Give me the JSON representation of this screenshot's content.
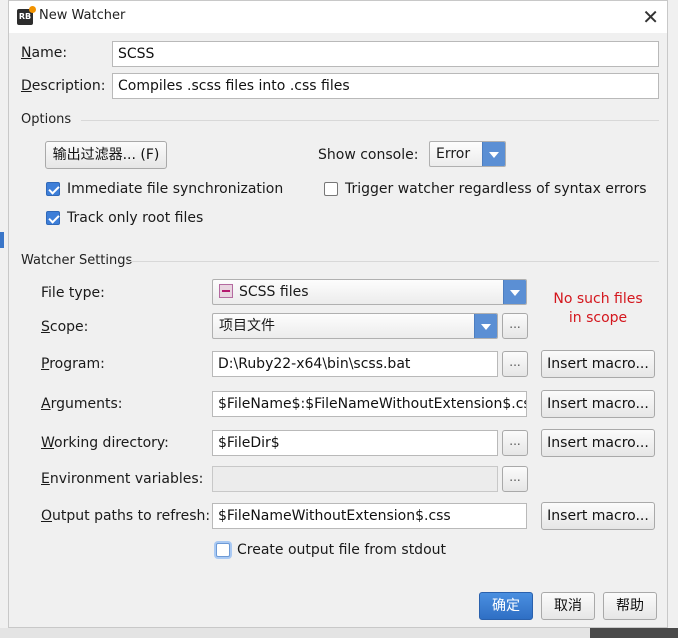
{
  "window": {
    "title": "New Watcher",
    "close_glyph": "✕"
  },
  "form": {
    "name_label": "Name:",
    "name_label_mn": "N",
    "name_label_rest": "ame:",
    "name_value": "SCSS",
    "description_label_mn": "D",
    "description_label_rest": "escription:",
    "description_value": "Compiles .scss files into .css files"
  },
  "options": {
    "title": "Options",
    "filter_button": "输出过滤器... (F)",
    "show_console_label": "Show console:",
    "show_console_value": "Error",
    "immediate_sync_label": "Immediate file synchronization",
    "immediate_sync_checked": true,
    "track_root_label": "Track only root files",
    "track_root_checked": true,
    "trigger_label": "Trigger watcher regardless of syntax errors",
    "trigger_checked": false
  },
  "watcher": {
    "title": "Watcher Settings",
    "file_type_label": "File type:",
    "file_type_value": "SCSS files",
    "file_type_icon": "sass-file-icon",
    "scope_label_mn": "S",
    "scope_label_rest": "cope:",
    "scope_value": "项目文件",
    "scope_error_line1": "No such files",
    "scope_error_line2": "in scope",
    "program_label_mn": "P",
    "program_label_rest": "rogram:",
    "program_value": "D:\\Ruby22-x64\\bin\\scss.bat",
    "arguments_label_mn": "A",
    "arguments_label_rest": "rguments:",
    "arguments_value": "$FileName$:$FileNameWithoutExtension$.css",
    "workdir_label_mn": "W",
    "workdir_label_rest": "orking directory:",
    "workdir_value": "$FileDir$",
    "env_label_mn": "E",
    "env_label_rest": "nvironment variables:",
    "env_value": "",
    "output_label_mn": "O",
    "output_label_rest": "utput paths to refresh:",
    "output_value": "$FileNameWithoutExtension$.css",
    "browse_glyph": "...",
    "insert_macro": "Insert macro...",
    "stdout_label": "Create output file from stdout",
    "stdout_checked": false
  },
  "footer": {
    "ok": "确定",
    "cancel": "取消",
    "help": "帮助"
  },
  "colors": {
    "accent": "#3d7ed8",
    "error": "#d4161d",
    "primary_button": "#2f6fc4"
  }
}
